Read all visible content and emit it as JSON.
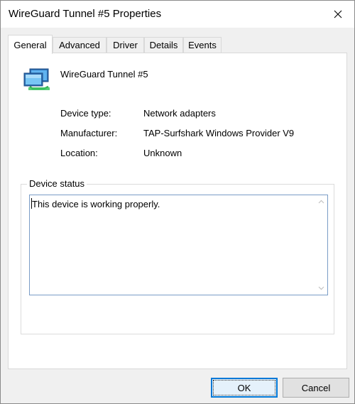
{
  "window": {
    "title": "WireGuard Tunnel #5 Properties"
  },
  "tabs": [
    {
      "label": "General",
      "active": true
    },
    {
      "label": "Advanced",
      "active": false
    },
    {
      "label": "Driver",
      "active": false
    },
    {
      "label": "Details",
      "active": false
    },
    {
      "label": "Events",
      "active": false
    }
  ],
  "general": {
    "device_name": "WireGuard Tunnel #5",
    "properties": [
      {
        "label": "Device type:",
        "value": "Network adapters"
      },
      {
        "label": "Manufacturer:",
        "value": "TAP-Surfshark Windows Provider V9"
      },
      {
        "label": "Location:",
        "value": "Unknown"
      }
    ],
    "status_group_title": "Device status",
    "status_text": "This device is working properly."
  },
  "buttons": {
    "ok": "OK",
    "cancel": "Cancel"
  },
  "icons": {
    "close": "close-icon",
    "device": "network-adapter-icon",
    "scroll_up": "scroll-up-arrow-icon",
    "scroll_down": "scroll-down-arrow-icon"
  },
  "colors": {
    "accent": "#0078d7",
    "panel_background": "#ffffff",
    "window_background": "#f0f0f0"
  }
}
